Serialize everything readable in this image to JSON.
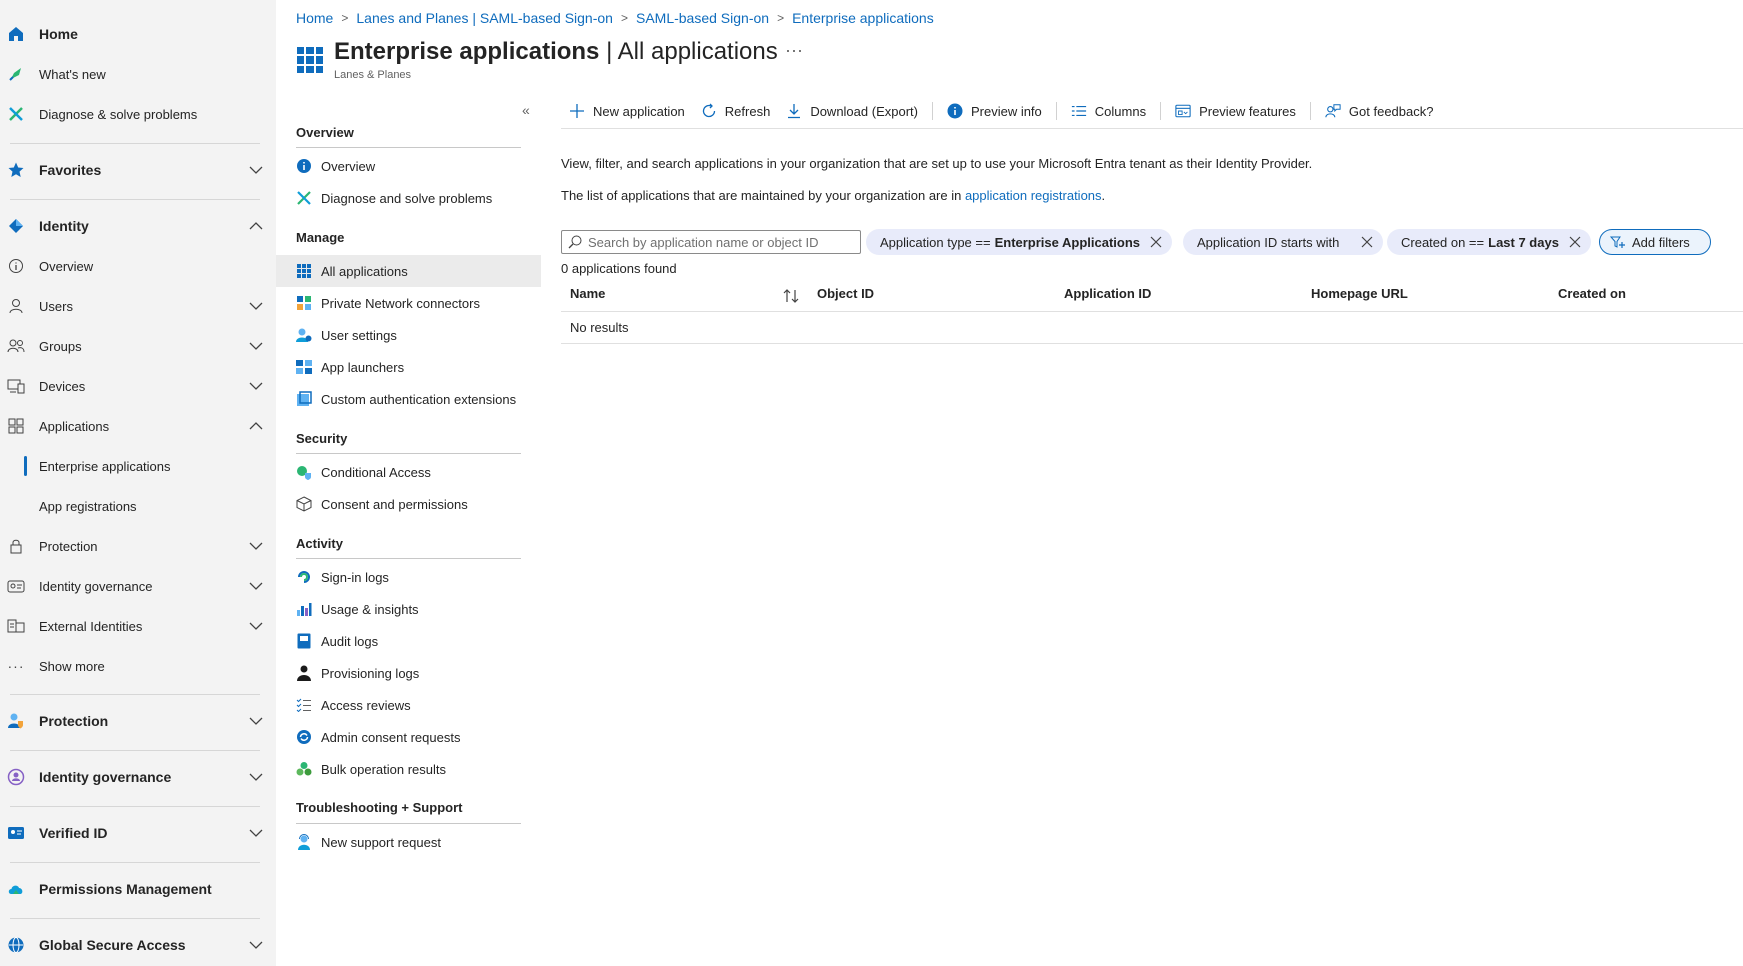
{
  "leftnav": {
    "home": "Home",
    "whats_new": "What's new",
    "diagnose": "Diagnose & solve problems",
    "favorites": "Favorites",
    "identity": "Identity",
    "overview": "Overview",
    "users": "Users",
    "groups": "Groups",
    "devices": "Devices",
    "applications": "Applications",
    "enterprise_apps": "Enterprise applications",
    "app_registrations": "App registrations",
    "protection_sub": "Protection",
    "identity_governance_sub": "Identity governance",
    "external_identities": "External Identities",
    "show_more": "Show more",
    "protection": "Protection",
    "identity_governance": "Identity governance",
    "verified_id": "Verified ID",
    "permissions_management": "Permissions Management",
    "global_secure_access": "Global Secure Access"
  },
  "breadcrumb": {
    "items": [
      "Home",
      "Lanes and Planes | SAML-based Sign-on",
      "SAML-based Sign-on",
      "Enterprise applications"
    ]
  },
  "header": {
    "title_bold": "Enterprise applications",
    "title_rest": " | All applications",
    "ellipsis": "···",
    "subtitle": "Lanes & Planes"
  },
  "menu": {
    "collapse": "«",
    "sections": {
      "overview": "Overview",
      "manage": "Manage",
      "security": "Security",
      "activity": "Activity",
      "troubleshooting": "Troubleshooting + Support"
    },
    "items": {
      "overview": "Overview",
      "diagnose": "Diagnose and solve problems",
      "all_apps": "All applications",
      "private_network": "Private Network connectors",
      "user_settings": "User settings",
      "app_launchers": "App launchers",
      "custom_auth": "Custom authentication extensions",
      "conditional_access": "Conditional Access",
      "consent": "Consent and permissions",
      "signin_logs": "Sign-in logs",
      "usage": "Usage & insights",
      "audit_logs": "Audit logs",
      "provisioning_logs": "Provisioning logs",
      "access_reviews": "Access reviews",
      "admin_consent": "Admin consent requests",
      "bulk_ops": "Bulk operation results",
      "new_support": "New support request"
    }
  },
  "toolbar": {
    "new_app": "New application",
    "refresh": "Refresh",
    "download": "Download (Export)",
    "preview_info": "Preview info",
    "columns": "Columns",
    "preview_features": "Preview features",
    "feedback": "Got feedback?"
  },
  "content": {
    "desc1": "View, filter, and search applications in your organization that are set up to use your Microsoft Entra tenant as their Identity Provider.",
    "desc2_prefix": "The list of applications that are maintained by your organization are in ",
    "desc2_link": "application registrations",
    "desc2_suffix": ".",
    "search_placeholder": "Search by application name or object ID",
    "filters": {
      "f1_label": "Application type ==",
      "f1_value": "Enterprise Applications",
      "f2_label": "Application ID starts with",
      "f3_label": "Created on ==",
      "f3_value": "Last 7 days",
      "add": "Add filters"
    },
    "found": "0 applications found",
    "columns": [
      "Name",
      "Object ID",
      "Application ID",
      "Homepage URL",
      "Created on"
    ],
    "no_results": "No results"
  }
}
